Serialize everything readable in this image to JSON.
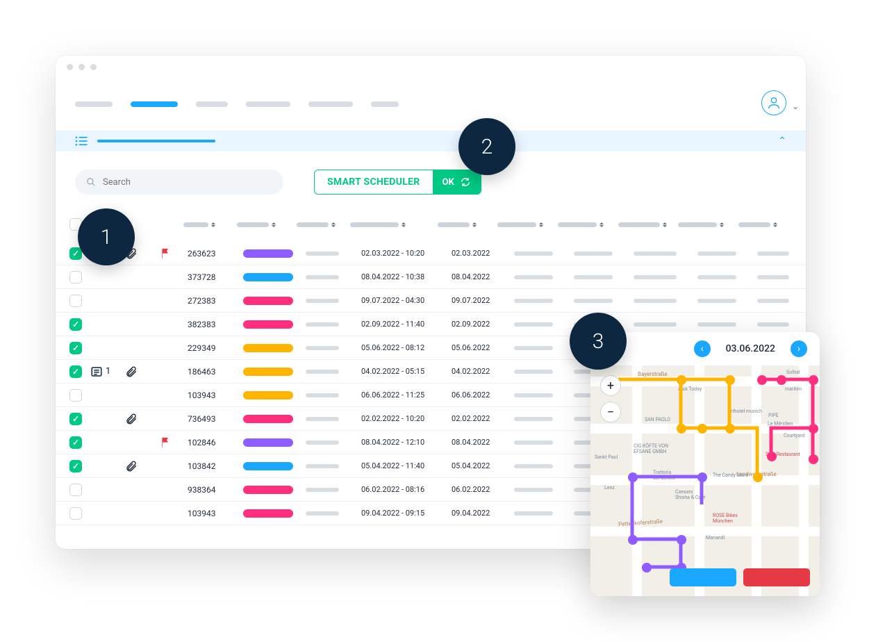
{
  "search": {
    "placeholder": "Search"
  },
  "scheduler": {
    "label": "SMART SCHEDULER",
    "ok": "OK"
  },
  "callouts": {
    "one": "1",
    "two": "2",
    "three": "3"
  },
  "map": {
    "date": "03.06.2022"
  },
  "tag_colors": {
    "purple": "#8f5cff",
    "blue": "#1aa7ff",
    "pink": "#ff2e7e",
    "orange": "#ffb400"
  },
  "rows": [
    {
      "checked": true,
      "note": false,
      "clip": true,
      "flag": true,
      "id": "263623",
      "tag": "purple",
      "datetime": "02.03.2022 - 10:20",
      "date": "02.03.2022"
    },
    {
      "checked": false,
      "note": false,
      "clip": false,
      "flag": false,
      "id": "373728",
      "tag": "blue",
      "datetime": "08.04.2022 - 10:38",
      "date": "08.04.2022"
    },
    {
      "checked": false,
      "note": false,
      "clip": false,
      "flag": false,
      "id": "272383",
      "tag": "pink",
      "datetime": "09.07.2022 - 04:30",
      "date": "09.07.2022"
    },
    {
      "checked": true,
      "note": false,
      "clip": false,
      "flag": false,
      "id": "382383",
      "tag": "pink",
      "datetime": "02.09.2022 - 11:40",
      "date": "02.09.2022"
    },
    {
      "checked": true,
      "note": false,
      "clip": false,
      "flag": false,
      "id": "229349",
      "tag": "orange",
      "datetime": "05.06.2022 - 08:12",
      "date": "05.06.2022"
    },
    {
      "checked": true,
      "note": true,
      "clip": true,
      "flag": false,
      "id": "186463",
      "tag": "orange",
      "datetime": "04.02.2022 - 05:15",
      "date": "04.02.2022"
    },
    {
      "checked": false,
      "note": false,
      "clip": false,
      "flag": false,
      "id": "103943",
      "tag": "orange",
      "datetime": "06.06.2022 - 11:25",
      "date": "06.06.2022"
    },
    {
      "checked": true,
      "note": false,
      "clip": true,
      "flag": false,
      "id": "736493",
      "tag": "pink",
      "datetime": "02.02.2022 - 10:20",
      "date": "02.02.2022"
    },
    {
      "checked": true,
      "note": false,
      "clip": false,
      "flag": true,
      "id": "102846",
      "tag": "purple",
      "datetime": "08.04.2022 - 12:10",
      "date": "08.04.2022"
    },
    {
      "checked": true,
      "note": false,
      "clip": true,
      "flag": false,
      "id": "103842",
      "tag": "blue",
      "datetime": "05.04.2022 - 11:40",
      "date": "05.04.2022"
    },
    {
      "checked": false,
      "note": false,
      "clip": false,
      "flag": false,
      "id": "938364",
      "tag": "pink",
      "datetime": "06.02.2022 - 08:16",
      "date": "06.02.2022"
    },
    {
      "checked": false,
      "note": false,
      "clip": false,
      "flag": false,
      "id": "103943",
      "tag": "pink",
      "datetime": "09.04.2022 - 09:15",
      "date": "09.04.2022"
    }
  ],
  "note_count": "1"
}
